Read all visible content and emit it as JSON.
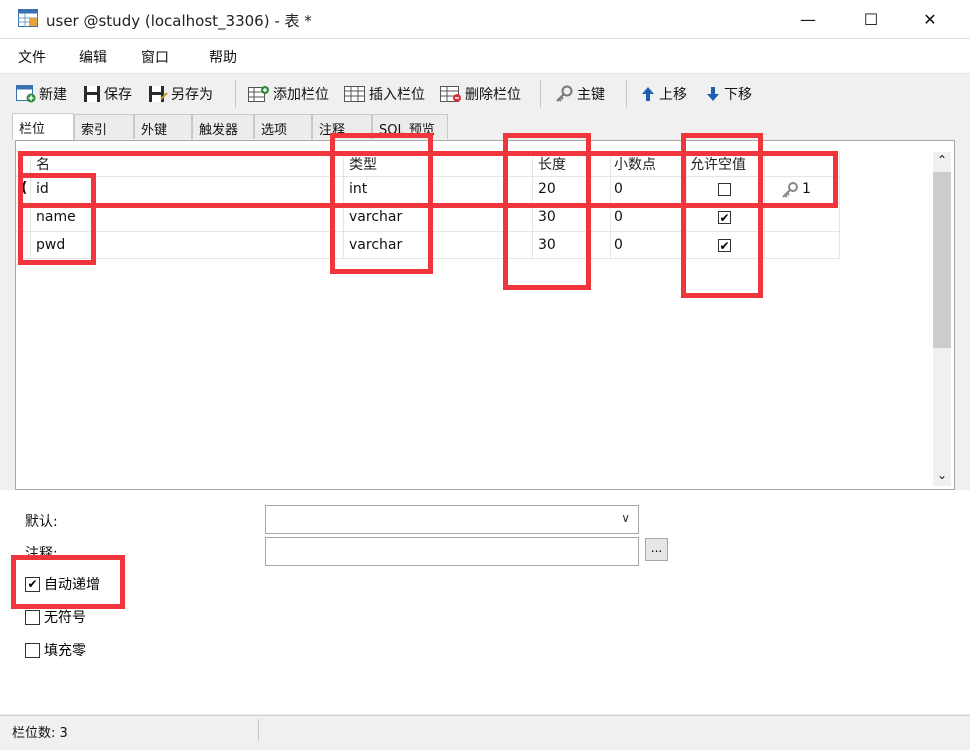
{
  "window": {
    "title": "user @study (localhost_3306) - 表 *",
    "minimize": "—",
    "maximize": "☐",
    "close": "✕"
  },
  "menu": [
    "文件",
    "编辑",
    "窗口",
    "帮助"
  ],
  "toolbar": {
    "new": "新建",
    "save": "保存",
    "save_as": "另存为",
    "add_field": "添加栏位",
    "insert_field": "插入栏位",
    "delete_field": "删除栏位",
    "primary_key": "主键",
    "move_up": "上移",
    "move_down": "下移"
  },
  "tabs": [
    "栏位",
    "索引",
    "外键",
    "触发器",
    "选项",
    "注释",
    "SQL 预览"
  ],
  "grid": {
    "headers": [
      "名",
      "类型",
      "长度",
      "小数点",
      "允许空值"
    ],
    "rows": [
      {
        "name": "id",
        "type": "int",
        "length": "20",
        "decimal": "0",
        "nullable": false,
        "key": "1"
      },
      {
        "name": "name",
        "type": "varchar",
        "length": "30",
        "decimal": "0",
        "nullable": true,
        "key": ""
      },
      {
        "name": "pwd",
        "type": "varchar",
        "length": "30",
        "decimal": "0",
        "nullable": true,
        "key": ""
      }
    ],
    "scroll_up": "⌃",
    "scroll_down": "⌄"
  },
  "properties": {
    "default_label": "默认:",
    "comment_label": "注释:",
    "dots": "...",
    "auto_increment": {
      "label": "自动递增",
      "checked": true
    },
    "unsigned": {
      "label": "无符号",
      "checked": false
    },
    "zerofill": {
      "label": "填充零",
      "checked": false
    }
  },
  "status": {
    "field_count": "栏位数: 3"
  },
  "colors": {
    "highlight": "#f0363c",
    "toolbar_blue": "#1e5fb3",
    "toolbar_green": "#2e8b3a"
  }
}
